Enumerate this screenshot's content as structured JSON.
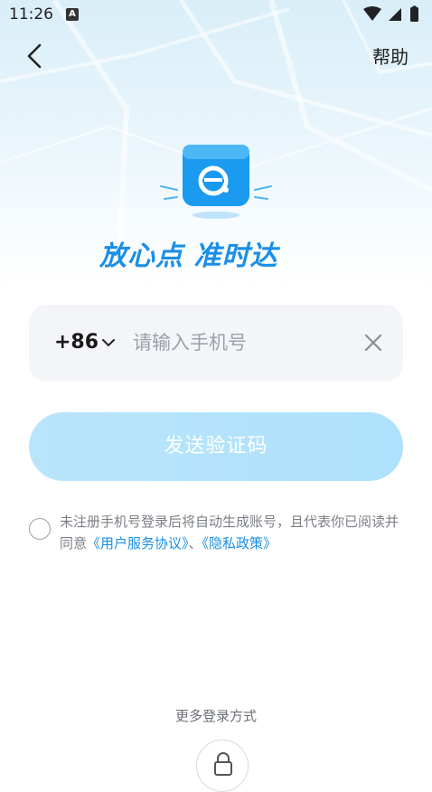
{
  "status_bar": {
    "time": "11:26",
    "notification_icon": "A"
  },
  "nav": {
    "back_icon": "chevron-left-icon",
    "help_label": "帮助"
  },
  "brand": {
    "logo_icon": "eleme-logo-icon",
    "slogan": "放心点 准时达",
    "accent_color": "#1a8fe6"
  },
  "phone": {
    "country_code": "+86",
    "placeholder": "请输入手机号",
    "value": ""
  },
  "send_code_button": {
    "label": "发送验证码"
  },
  "agreement": {
    "prefix": "未注册手机号登录后将自动生成账号，且代表你已阅读并同意",
    "user_agreement": "《用户服务协议》",
    "separator": "、",
    "privacy_policy": "《隐私政策》"
  },
  "more_login": {
    "label": "更多登录方式",
    "icon": "lock-icon"
  }
}
